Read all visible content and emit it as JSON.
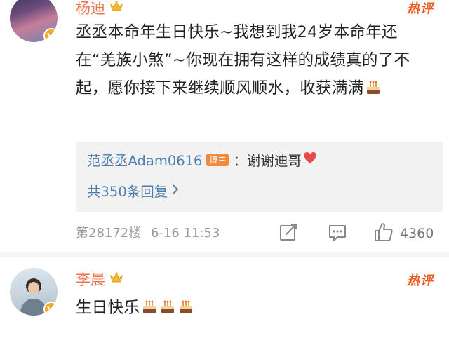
{
  "comments": [
    {
      "user": "杨迪",
      "hot_label": "热评",
      "text": "丞丞本命年生日快乐~我想到我24岁本命年还在“羌族小煞”~你现在拥有这样的成绩真的了不起，愿你接下来继续顺风顺水，收获满满",
      "reply": {
        "user": "范丞丞Adam0616",
        "badge": "博主",
        "text": "：谢谢迪哥",
        "count_label": "共350条回复"
      },
      "floor": "第28172楼",
      "time": "6-16 11:53",
      "likes": "4360"
    },
    {
      "user": "李晨",
      "hot_label": "热评",
      "text": "生日快乐"
    }
  ],
  "icons": [
    "crown-icon",
    "verified-icon",
    "cake-icon",
    "share-icon",
    "comment-icon",
    "like-icon",
    "chevron-right-icon"
  ],
  "colors": {
    "name": "#eb7350",
    "hot": "#f15a22",
    "link": "#507daf",
    "verified": "#f5a623"
  }
}
